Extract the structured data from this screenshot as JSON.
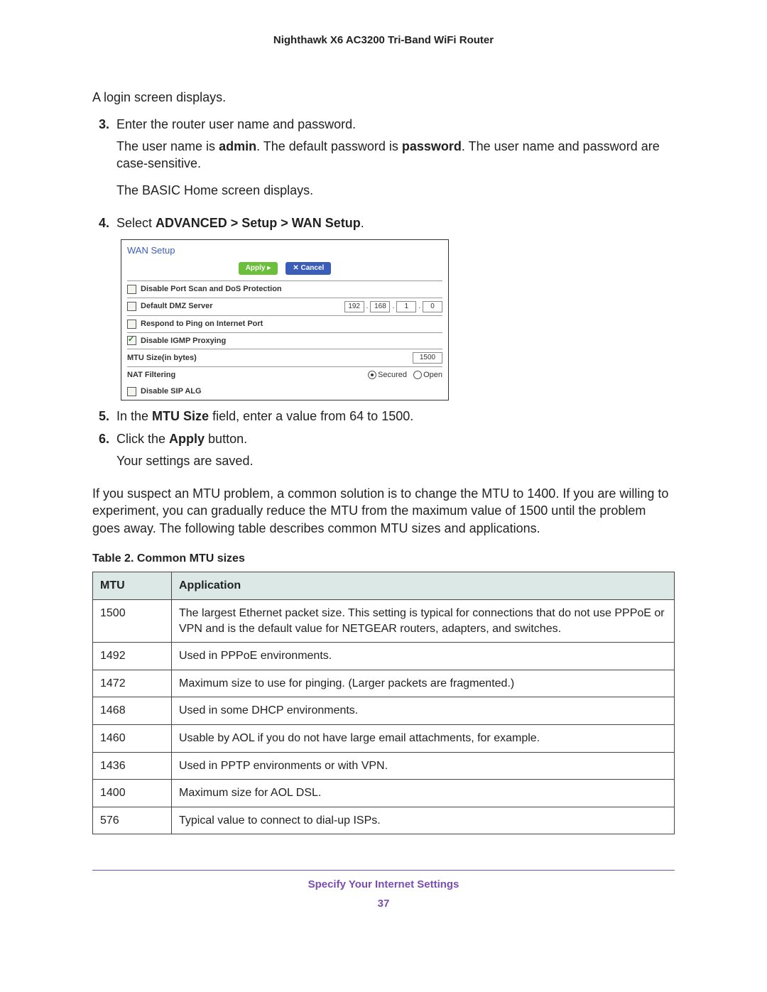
{
  "header": {
    "title": "Nighthawk X6 AC3200 Tri-Band WiFi Router"
  },
  "body": {
    "p_login": "A login screen displays.",
    "step3": {
      "num": "3.",
      "line1": "Enter the router user name and password.",
      "line2a": "The user name is ",
      "line2b": "admin",
      "line2c": ". The default password is ",
      "line2d": "password",
      "line2e": ". The user name and password are case-sensitive.",
      "line3": "The BASIC Home screen displays."
    },
    "step4": {
      "num": "4.",
      "prefix": "Select ",
      "bold": "ADVANCED > Setup > WAN Setup",
      "suffix": "."
    },
    "step5": {
      "num": "5.",
      "a": "In the ",
      "b": "MTU Size",
      "c": " field, enter a value from 64 to 1500."
    },
    "step6": {
      "num": "6.",
      "a": "Click the ",
      "b": "Apply",
      "c": " button.",
      "sub": "Your settings are saved."
    },
    "p_mtu": "If you suspect an MTU problem, a common solution is to change the MTU to 1400. If you are willing to experiment, you can gradually reduce the MTU from the maximum value of 1500 until the problem goes away. The following table describes common MTU sizes and applications."
  },
  "figure": {
    "title": "WAN Setup",
    "btn_apply": "Apply ▸",
    "btn_cancel": "✕ Cancel",
    "row_portscan": "Disable Port Scan and DoS Protection",
    "row_dmz": "Default DMZ Server",
    "ip": [
      "192",
      "168",
      "1",
      "0"
    ],
    "row_ping": "Respond to Ping on Internet Port",
    "row_igmp": "Disable IGMP Proxying",
    "row_mtu": "MTU Size(in bytes)",
    "mtu": "1500",
    "row_nat": "NAT Filtering",
    "nat_secured": "Secured",
    "nat_open": "Open",
    "row_sip": "Disable SIP ALG"
  },
  "table": {
    "caption": "Table 2.  Common MTU sizes",
    "head": [
      "MTU",
      "Application"
    ],
    "rows": [
      [
        "1500",
        "The largest Ethernet packet size. This setting is typical for connections that do not use PPPoE or VPN and is the default value for NETGEAR routers, adapters, and switches."
      ],
      [
        "1492",
        "Used in PPPoE environments."
      ],
      [
        "1472",
        "Maximum size to use for pinging. (Larger packets are fragmented.)"
      ],
      [
        "1468",
        "Used in some DHCP environments."
      ],
      [
        "1460",
        "Usable by AOL if you do not have large email attachments, for example."
      ],
      [
        "1436",
        "Used in PPTP environments or with VPN."
      ],
      [
        "1400",
        "Maximum size for AOL DSL."
      ],
      [
        "576",
        "Typical value to connect to dial-up ISPs."
      ]
    ]
  },
  "footer": {
    "section": "Specify Your Internet Settings",
    "page": "37"
  }
}
